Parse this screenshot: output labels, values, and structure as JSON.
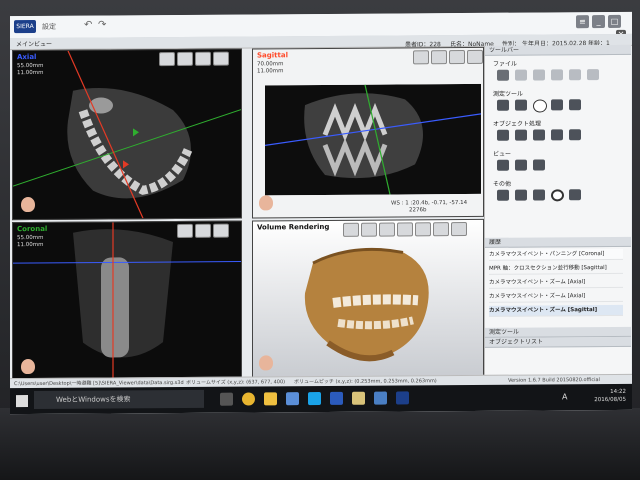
{
  "titlebar": {
    "app_logo": "SIERA",
    "menu1": "設定"
  },
  "tab": {
    "label": "メインビュー"
  },
  "patient": {
    "id": "患者ID：228",
    "name": "氏名：NoName",
    "sex": "性別：",
    "dob": "生年月日：2015.02.28",
    "age": "年齢：1"
  },
  "views": {
    "axial": {
      "label": "Axial",
      "thickness": "55.00mm",
      "slice": "11.00mm"
    },
    "sagittal": {
      "label": "Sagittal",
      "thickness": "70.00mm",
      "slice": "11.00mm",
      "ws": "WS : 1 :20.4b, -0.71, -57.14",
      "wl": "2276b"
    },
    "coronal": {
      "label": "Coronal",
      "thickness": "55.00mm",
      "slice": "11.00mm"
    },
    "volume": {
      "label": "Volume Rendering"
    }
  },
  "panel": {
    "toolbar_title": "ツールバー",
    "file": "ファイル",
    "measure": "測定ツール",
    "object": "オブジェクト処理",
    "view": "ビュー",
    "other": "その他",
    "history_title": "履歴",
    "history": [
      "カメラマウスイベント・パンニング [Coronal]",
      "MPR 軸：クロスセクション並行移動 [Sagittal]",
      "カメラマウスイベント・ズーム [Axial]",
      "カメラマウスイベント・ズーム [Axial]",
      "カメラマウスイベント・ズーム [Sagittal]"
    ],
    "measure_tool": "測定ツール",
    "object_list": "オブジェクトリスト"
  },
  "statusbar": {
    "path": "C:\\Users\\user\\Desktop\\一時避難 [5]\\SIERA_Viewer\\data\\Data.sirg.s3d",
    "volume_size": "ボリュームサイズ (x,y,z): (637, 677, 400)",
    "voxel": "ボリュームピッチ (x,y,z): (0.253mm, 0.253mm, 0.263mm)",
    "version": "Version 1.6.7 Build 20150820.official"
  },
  "taskbar": {
    "search": "WebとWindowsを検索",
    "time": "14:22",
    "date": "2016/08/05",
    "ime": "A"
  },
  "colors": {
    "axial_label": "#3a5cff",
    "sagittal_label": "#ff4a2a",
    "coronal_label": "#2fae2f",
    "bone": "#c89a55"
  }
}
